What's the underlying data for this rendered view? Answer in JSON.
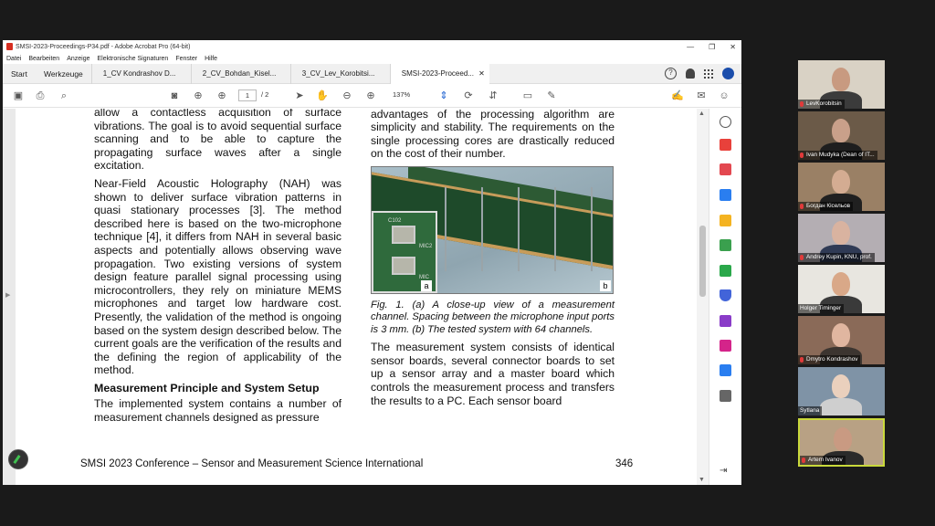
{
  "acrobat": {
    "title": "SMSI-2023-Proceedings-P34.pdf - Adobe Acrobat Pro (64-bit)",
    "menu": [
      "Datei",
      "Bearbeiten",
      "Anzeige",
      "Elektronische Signaturen",
      "Fenster",
      "Hilfe"
    ],
    "nav_tabs": [
      "Start",
      "Werkzeuge"
    ],
    "doc_tabs": [
      {
        "label": "1_CV Kondrashov D...",
        "active": false
      },
      {
        "label": "2_CV_Bohdan_Kisel...",
        "active": false
      },
      {
        "label": "3_CV_Lev_Korobitsi...",
        "active": false
      },
      {
        "label": "SMSI-2023-Proceed...",
        "active": true
      }
    ],
    "toolbar": {
      "current_page": "1",
      "total_pages": "/ 2",
      "zoom": "137%"
    },
    "icons": [
      "help-icon",
      "bell-icon",
      "apps-icon",
      "account-globe-icon",
      "save-icon",
      "print-icon",
      "search-icon",
      "snapshot-icon",
      "prev-page-icon",
      "next-page-icon",
      "select-icon",
      "hand-icon",
      "zoom-out-icon",
      "zoom-in-icon",
      "fit-icon",
      "rotate-icon",
      "scroll-mode-icon",
      "comment-icon",
      "pen-icon",
      "sign-icon",
      "mail-icon",
      "share-icon"
    ]
  },
  "document": {
    "left_col": {
      "p1": "allow a contactless acquisition of surface vibrations. The goal is to avoid sequential surface scanning and to be able to capture the propagating surface waves after a single excitation.",
      "p2": "Near-Field Acoustic Holography (NAH) was shown to deliver surface vibration patterns in quasi stationary processes [3]. The method described here is based on the two-microphone technique [4], it differs from NAH in several basic aspects and potentially allows observing wave propagation. Two existing versions of system design feature parallel signal processing using microcontrollers, they rely on miniature MEMS microphones and target low hardware cost. Presently, the validation of the method is ongoing based on the system design described below. The current goals are the verification of the results and the defining the region of applicability of the method.",
      "heading": "Measurement Principle and System Setup",
      "p3": "The implemented system contains a number of measurement channels designed as pressure"
    },
    "right_col": {
      "p0": "data must be combined for visualization. Key advantages of the processing algorithm are simplicity and stability. The requirements on the single processing cores are drastically reduced on the cost of their number.",
      "figure_labels": {
        "a": "a",
        "b": "b",
        "c102": "C102",
        "mic2": "MIC2",
        "mic": "MIC"
      },
      "caption": "Fig. 1. (a) A close-up view of a measurement channel. Spacing between the microphone input ports is 3 mm. (b) The tested system with 64 channels.",
      "p1": "The measurement system consists of identical sensor boards, several connector boards to set up a sensor array and a master board which controls the measurement process and transfers the results to a PC. Each sensor board"
    },
    "footer_left": "SMSI 2023 Conference – Sensor and Measurement Science International",
    "footer_right": "346"
  },
  "participants": [
    {
      "name": "LevKorobitsin",
      "muted": true,
      "active": false,
      "bg": "#d9d2c5",
      "skin": "#c89a80",
      "shirt": "#3b3b3b"
    },
    {
      "name": "Ivan Mudyka (Dean of IT...",
      "muted": true,
      "active": false,
      "bg": "#6b5a48",
      "skin": "#c9a08a",
      "shirt": "#1e1e1e"
    },
    {
      "name": "Богдан Кісельов",
      "muted": true,
      "active": false,
      "bg": "#9a8065",
      "skin": "#d4ac92",
      "shirt": "#202020"
    },
    {
      "name": "Andrey Kupin, KNU, prof.",
      "muted": true,
      "active": false,
      "bg": "#b4aeb3",
      "skin": "#d9b3a0",
      "shirt": "#2f3a55"
    },
    {
      "name": "Holger Timinger",
      "muted": false,
      "active": false,
      "bg": "#e8e6e0",
      "skin": "#d9a888",
      "shirt": "#3a3a3a"
    },
    {
      "name": "Dmytro Kondrashov",
      "muted": true,
      "active": false,
      "bg": "#8a6a58",
      "skin": "#e0b6a0",
      "shirt": "#3c3530"
    },
    {
      "name": "Sytlana",
      "muted": false,
      "active": false,
      "bg": "#7f93a6",
      "skin": "#ead0bd",
      "shirt": "#cfcfcf"
    },
    {
      "name": "Artem Ivanov",
      "muted": true,
      "active": true,
      "bg": "#b8a184",
      "skin": "#c99a82",
      "shirt": "#2a2a2a"
    }
  ]
}
